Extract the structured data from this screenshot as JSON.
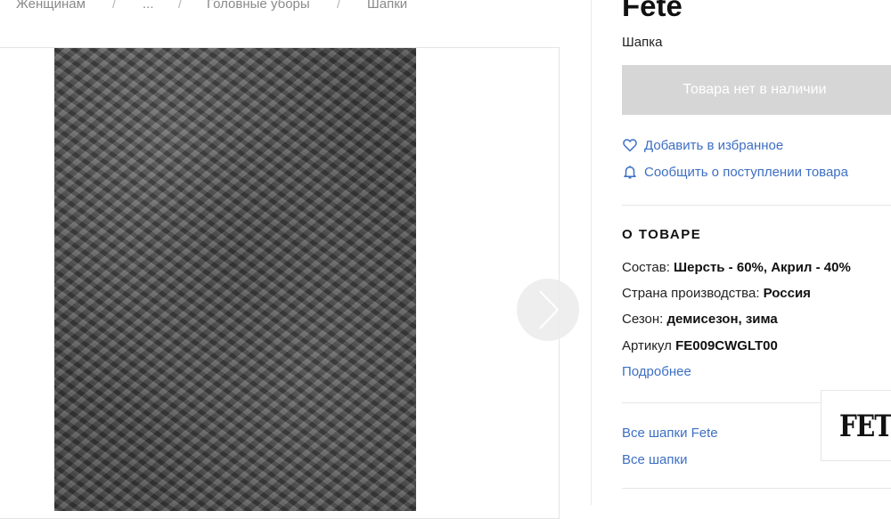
{
  "breadcrumb": {
    "items": [
      "Женщинам",
      "...",
      "Головные уборы",
      "Шапки"
    ],
    "separator": "/"
  },
  "product": {
    "brand": "Fete",
    "type": "Шапка",
    "availability_button": "Товара нет в наличии"
  },
  "actions": {
    "favorite_label": "Добавить в избранное",
    "notify_label": "Сообщить о поступлении товара"
  },
  "about": {
    "title": "О ТОВАРЕ",
    "composition_label": "Состав:",
    "composition_value": "Шерсть - 60%, Акрил - 40%",
    "country_label": "Страна производства:",
    "country_value": "Россия",
    "season_label": "Сезон:",
    "season_value": "демисезон, зима",
    "sku_label": "Артикул",
    "sku_value": "FE009CWGLT00",
    "more_link": "Подробнее"
  },
  "links": {
    "all_brand_hats": "Все шапки Fete",
    "all_hats": "Все шапки"
  },
  "brand_logo_text": "FETE",
  "icons": {
    "favorite": "heart-icon",
    "notify": "bell-icon",
    "next": "chevron-right-icon"
  },
  "colors": {
    "link": "#3d6fc4",
    "disabled_button": "#d6d6d6"
  }
}
